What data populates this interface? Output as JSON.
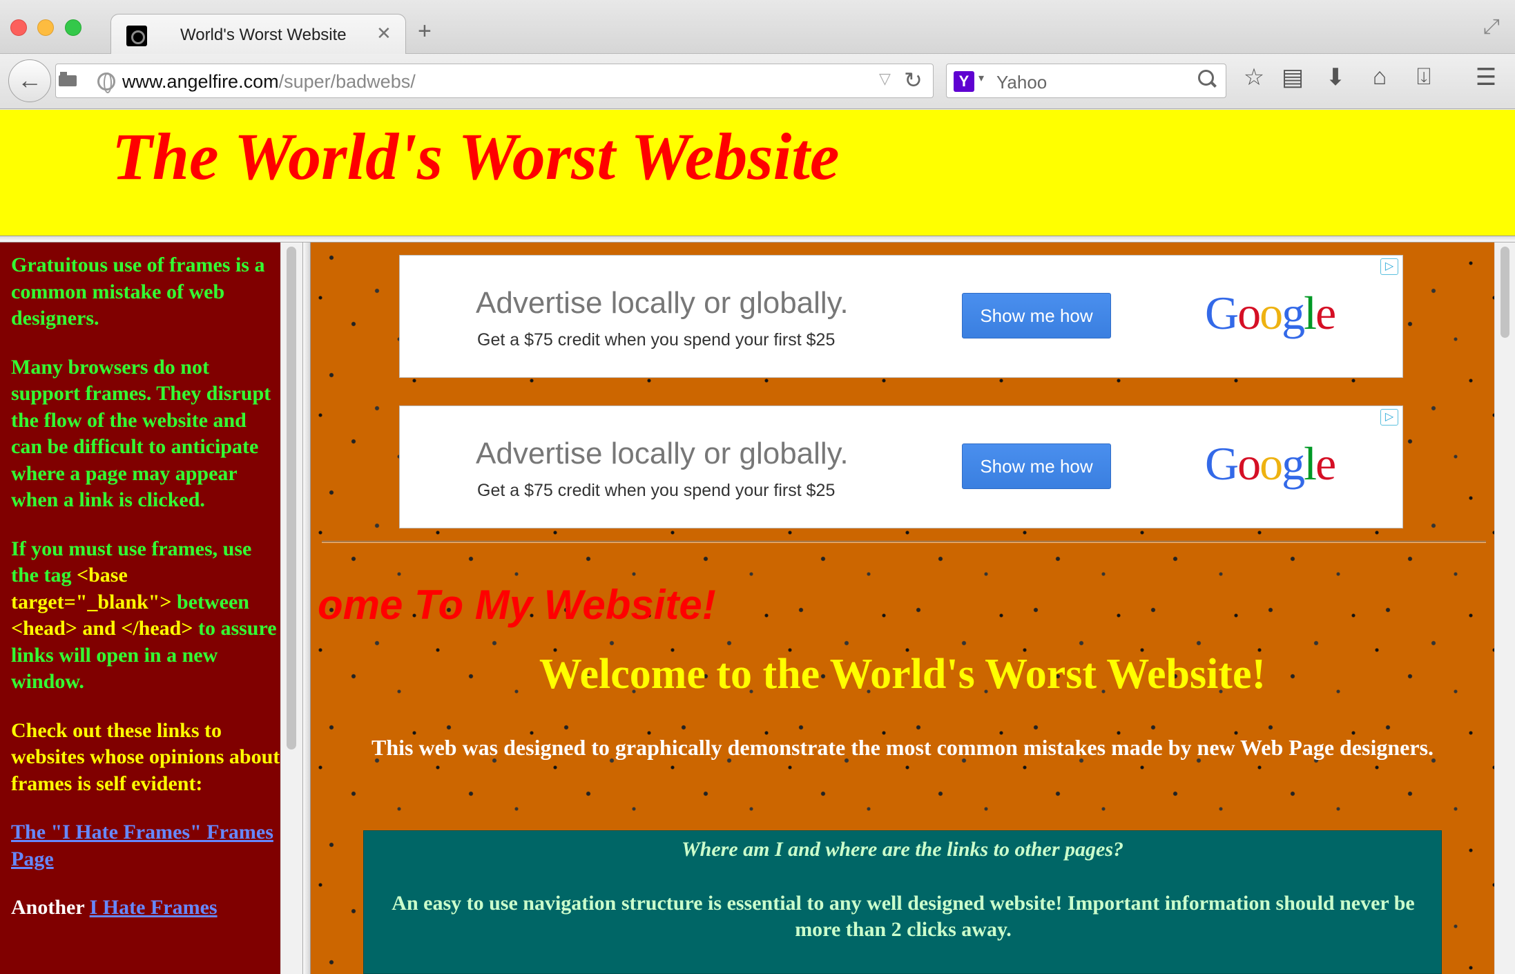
{
  "browser": {
    "tab_title": "World's Worst Website",
    "tab_close": "✕",
    "new_tab": "+",
    "url_host": "www.angelfire.com",
    "url_path": "/super/badwebs/",
    "search_engine": "Yahoo",
    "yahoo_letter": "Y"
  },
  "top_frame": {
    "title": "The World's Worst Website"
  },
  "left_frame": {
    "p1": "Gratuitous use of frames is a common mistake of web designers.",
    "p2": "Many browsers do not support frames. They disrupt the flow of the website and can be difficult to anticipate where a page may appear when a link is clicked.",
    "p3_a": "If you must use frames, use the tag ",
    "p3_code": "<base target=\"_blank\">",
    "p3_b": " between ",
    "p3_code2": "<head> and </head>",
    "p3_c": " to assure links will open in a new window.",
    "p4": "Check out these links to websites whose opinions about frames is self evident:",
    "link1": "The \"I Hate Frames\" Frames Page",
    "p5_prefix": "Another ",
    "link2": "I Hate Frames"
  },
  "ads": [
    {
      "headline": "Advertise locally or globally.",
      "sub": "Get a $75 credit when you spend your first $25",
      "button": "Show me how",
      "choice": "▷"
    },
    {
      "headline": "Advertise locally or globally.",
      "sub": "Get a $75 credit when you spend your first $25",
      "button": "Show me how",
      "choice": "▷"
    }
  ],
  "google_logo": [
    "G",
    "o",
    "o",
    "g",
    "l",
    "e"
  ],
  "google_colors": [
    "#3369e8",
    "#d50f25",
    "#eeb211",
    "#3369e8",
    "#009925",
    "#d50f25"
  ],
  "main": {
    "marquee": "ome To My Website!",
    "welcome": "Welcome to the World's Worst Website!",
    "intro": "This web was designed to graphically demonstrate the most common mistakes made by new Web Page designers.",
    "nav_question": "Where am I and where are the links to other pages?",
    "nav_answer": "An easy to use navigation structure is essential to any well designed website! Important information should never be more than 2 clicks away."
  }
}
